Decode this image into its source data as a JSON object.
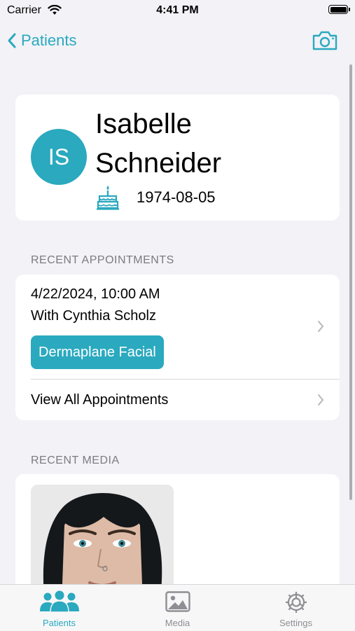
{
  "status_bar": {
    "carrier": "Carrier",
    "time": "4:41 PM"
  },
  "nav": {
    "back_label": "Patients"
  },
  "patient": {
    "initials": "IS",
    "first_name": "Isabelle",
    "last_name": "Schneider",
    "birth_date": "1974-08-05"
  },
  "sections": {
    "appointments_header": "RECENT APPOINTMENTS",
    "media_header": "RECENT MEDIA"
  },
  "appointment": {
    "datetime": "4/22/2024, 10:00 AM",
    "with": "With Cynthia Scholz",
    "service": "Dermaplane Facial"
  },
  "view_all_label": "View All Appointments",
  "tabs": [
    {
      "label": "Patients",
      "icon": "people-icon",
      "active": true
    },
    {
      "label": "Media",
      "icon": "photo-icon",
      "active": false
    },
    {
      "label": "Settings",
      "icon": "gear-icon",
      "active": false
    }
  ],
  "colors": {
    "accent": "#2aa9bf",
    "background": "#f2f2f7",
    "secondary_text": "#7b7b80"
  }
}
